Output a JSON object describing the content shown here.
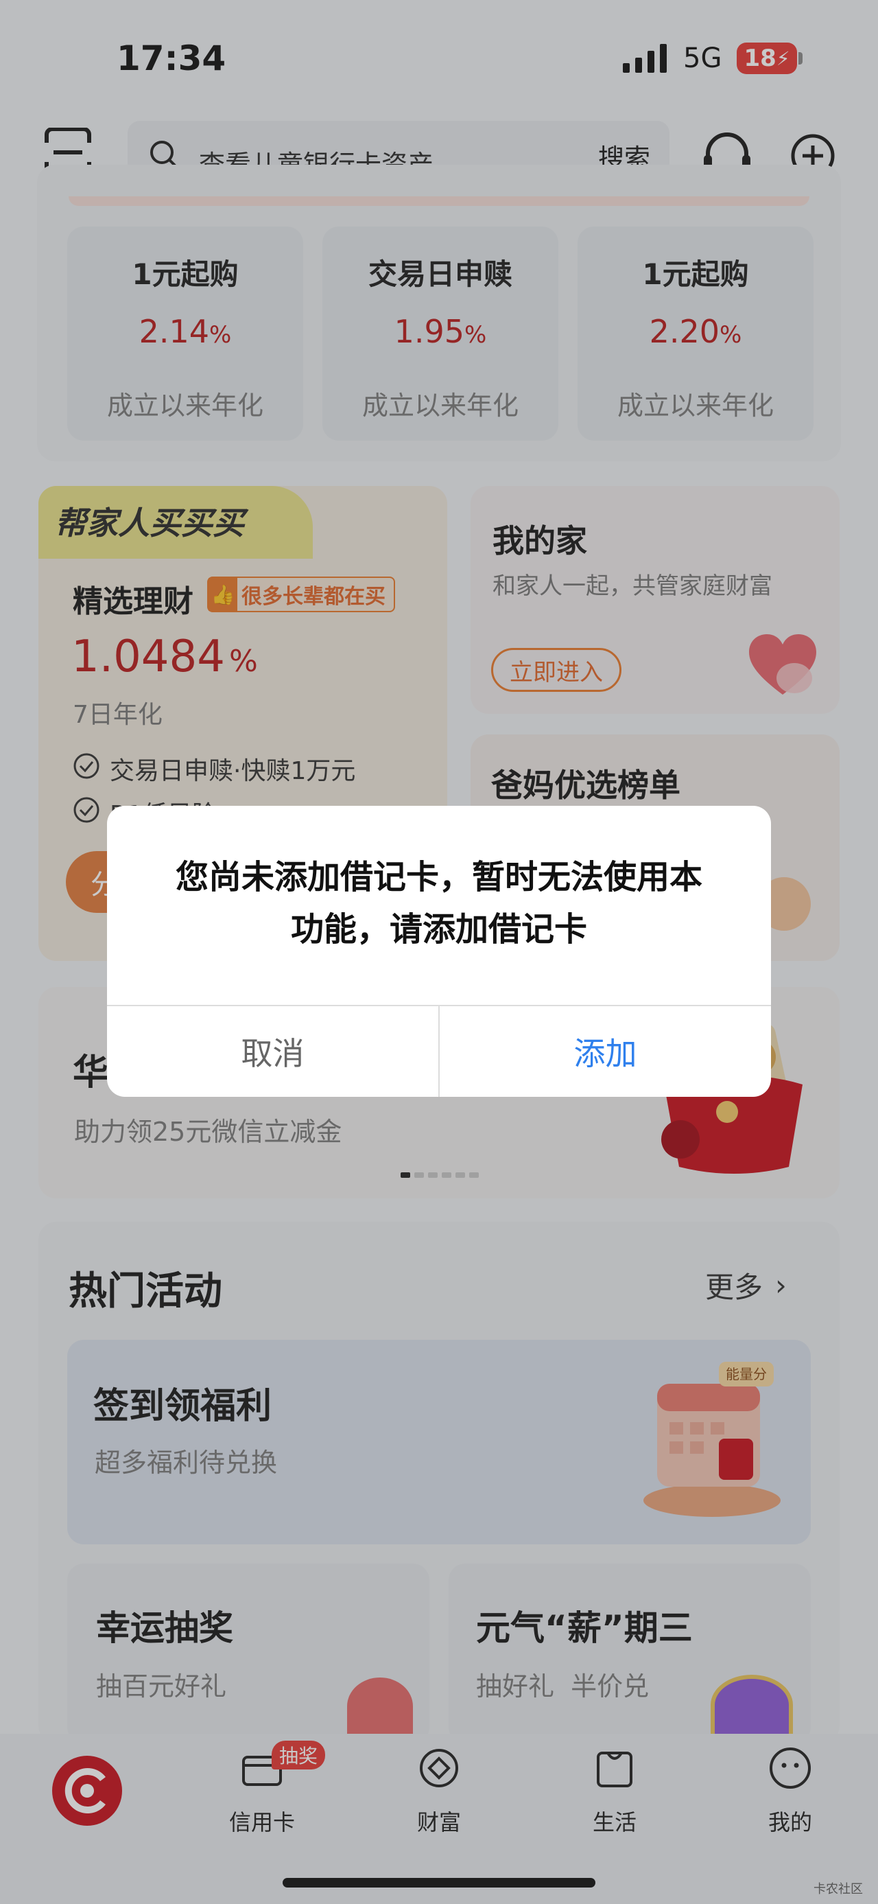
{
  "status_bar": {
    "time": "17:34",
    "network": "5G",
    "battery": "18"
  },
  "header": {
    "search_placeholder": "查看儿童银行卡资产",
    "search_button": "搜索"
  },
  "funds": [
    {
      "title": "1元起购",
      "rate": "2.14",
      "unit": "%",
      "sub": "成立以来年化"
    },
    {
      "title": "交易日申赎",
      "rate": "1.95",
      "unit": "%",
      "sub": "成立以来年化"
    },
    {
      "title": "1元起购",
      "rate": "2.20",
      "unit": "%",
      "sub": "成立以来年化"
    }
  ],
  "family_card": {
    "banner": "帮家人买买买",
    "title": "精选理财",
    "tag": "很多长辈都在买",
    "rate": "1.0484",
    "unit": "%",
    "rate_label": "7日年化",
    "features": [
      "交易日申赎·快赎1万元",
      "R1低风险"
    ],
    "button_partial": "分"
  },
  "home_card": {
    "title": "我的家",
    "subtitle": "和家人一起，共管家庭财富",
    "button": "立即进入"
  },
  "parents_card": {
    "title": "爸妈优选榜单"
  },
  "promo": {
    "title_partial": "华",
    "subtitle": "助力领25元微信立减金",
    "coin": "金"
  },
  "activities": {
    "title": "热门活动",
    "more": "更多",
    "signin": {
      "title": "签到领福利",
      "subtitle": "超多福利待兑换",
      "badge": "能量分"
    },
    "lottery": {
      "title": "幸运抽奖",
      "subtitle": "抽百元好礼"
    },
    "wednesday": {
      "title": "元气“薪”期三",
      "subtitle": "抽好礼  半价兑"
    }
  },
  "dialog": {
    "message_line1": "您尚未添加借记卡，暂时无法使用本",
    "message_line2": "功能，请添加借记卡",
    "cancel": "取消",
    "add": "添加"
  },
  "tabbar": {
    "items": [
      {
        "label": "信用卡",
        "badge": "抽奖"
      },
      {
        "label": "财富"
      },
      {
        "label": "生活"
      },
      {
        "label": "我的"
      }
    ]
  },
  "watermark": "卡农社区",
  "colors": {
    "accent_red": "#b71c1c",
    "link_blue": "#2f80ed",
    "orange": "#e8792b"
  }
}
